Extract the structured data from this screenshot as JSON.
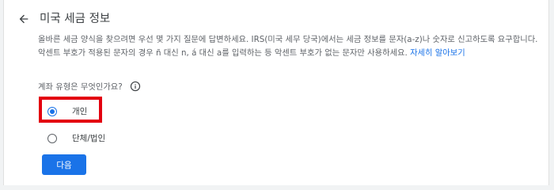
{
  "header": {
    "back_icon": "arrow-back-icon",
    "title": "미국 세금 정보"
  },
  "description": {
    "line1": "올바른 세금 양식을 찾으려면 우선 몇 가지 질문에 답변하세요. IRS(미국 세무 당국)에서는 세금 정보를 문자(a-z)나 숫자로 신고하도록 요구합니다.",
    "line2": "악센트 부호가 적용된 문자의 경우 ñ 대신 n, á 대신 a를 입력하는 등 악센트 부호가 없는 문자만 사용하세요.",
    "learn_more_link": "자세히 알아보기"
  },
  "question": {
    "label": "계좌 유형은 무엇인가요?",
    "info_icon": "info-icon"
  },
  "options": [
    {
      "label": "개인",
      "selected": true
    },
    {
      "label": "단체/법인",
      "selected": false
    }
  ],
  "next_button": "다음",
  "colors": {
    "accent": "#1a73e8",
    "highlight": "#e3000f"
  }
}
